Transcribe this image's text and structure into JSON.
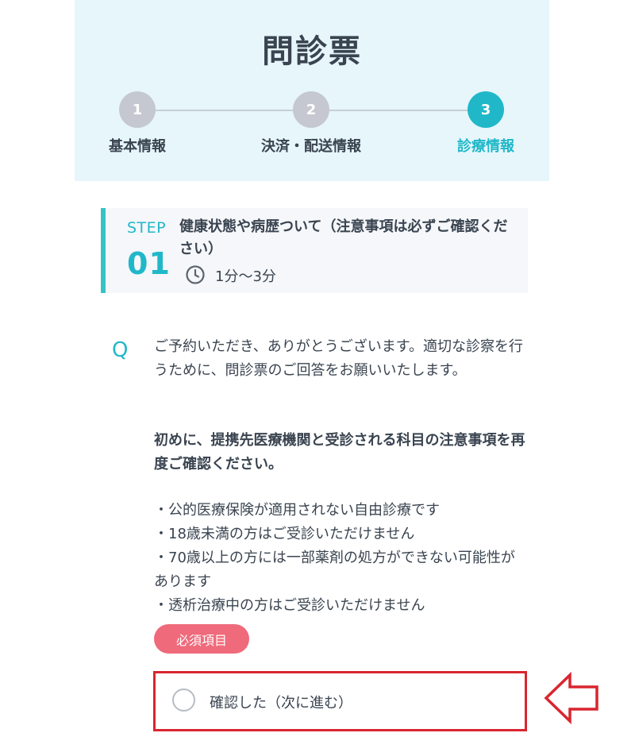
{
  "header": {
    "title": "問診票",
    "steps": [
      {
        "number": "1",
        "label": "基本情報",
        "state": "done"
      },
      {
        "number": "2",
        "label": "決済・配送情報",
        "state": "done"
      },
      {
        "number": "3",
        "label": "診療情報",
        "state": "active"
      }
    ]
  },
  "step_card": {
    "step_word": "STEP",
    "step_number": "01",
    "title": "健康状態や病歴ついて（注意事項は必ずご確認ください）",
    "duration": "1分〜3分",
    "icon": "clock-icon"
  },
  "question": {
    "mark": "Q",
    "intro": "ご予約いただき、ありがとうございます。適切な診察を行うために、問診票のご回答をお願いいたします。",
    "emphasis": "初めに、提携先医療機関と受診される科目の注意事項を再度ご確認ください。",
    "bullets": [
      "・公的医療保険が適用されない自由診療です",
      "・18歳未満の方はご受診いただけません",
      "・70歳以上の方には一部薬剤の処方ができない可能性があります",
      "・透析治療中の方はご受診いただけません"
    ],
    "required_label": "必須項目"
  },
  "option": {
    "label": "確認した（次に進む）",
    "selected": false
  },
  "colors": {
    "accent": "#20b8c9",
    "header_bg": "#e6f6fb",
    "required": "#ef6a7b",
    "highlight_border": "#d9252f",
    "inactive_step": "#c5c8d0"
  }
}
